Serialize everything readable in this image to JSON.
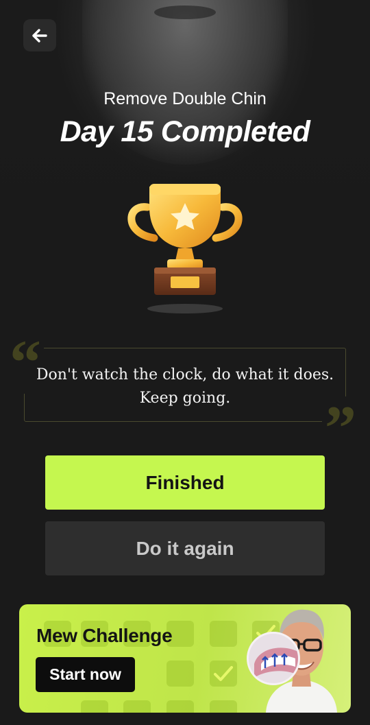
{
  "header": {
    "back_icon": "arrow-left-icon",
    "subtitle": "Remove Double Chin",
    "title": "Day 15 Completed"
  },
  "trophy": {
    "icon": "trophy-icon"
  },
  "quote": {
    "text_line1": "Don't watch the clock, do what it does.",
    "text_line2": "Keep going.",
    "open_mark": "“",
    "close_mark": "”"
  },
  "actions": {
    "finished_label": "Finished",
    "again_label": "Do it again"
  },
  "banner": {
    "title": "Mew Challenge",
    "cta_label": "Start now"
  },
  "colors": {
    "accent": "#c5f74f",
    "background": "#1a1a1a",
    "secondary_button": "#2e2e2e"
  }
}
